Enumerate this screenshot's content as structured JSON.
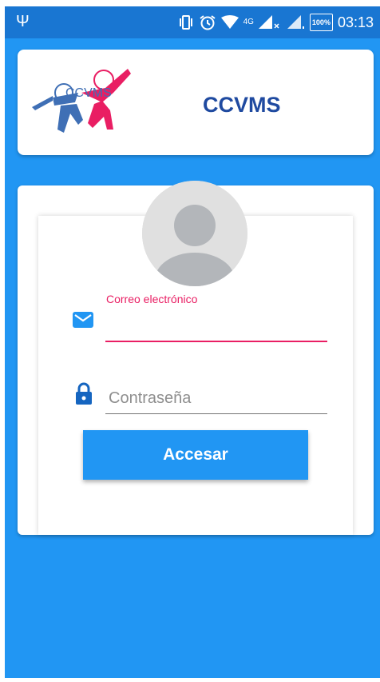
{
  "status_bar": {
    "time": "03:13",
    "network": "4G",
    "battery": "100%",
    "icons": [
      "usb-icon",
      "vibrate-icon",
      "alarm-icon",
      "wifi-icon",
      "signal-icon",
      "signal-icon",
      "battery-icon"
    ]
  },
  "header": {
    "logo_text": "CCVMS",
    "title": "CCVMS"
  },
  "login": {
    "avatar_icon": "user-avatar-icon",
    "email_label": "Correo electrónico",
    "email_value": "",
    "email_icon": "envelope-icon",
    "password_placeholder": "Contraseña",
    "password_value": "",
    "password_icon": "lock-icon",
    "submit_label": "Accesar"
  },
  "colors": {
    "primary": "#2196F3",
    "status_bar": "#1976D2",
    "title": "#1F4AA0",
    "accent": "#E91E63"
  }
}
